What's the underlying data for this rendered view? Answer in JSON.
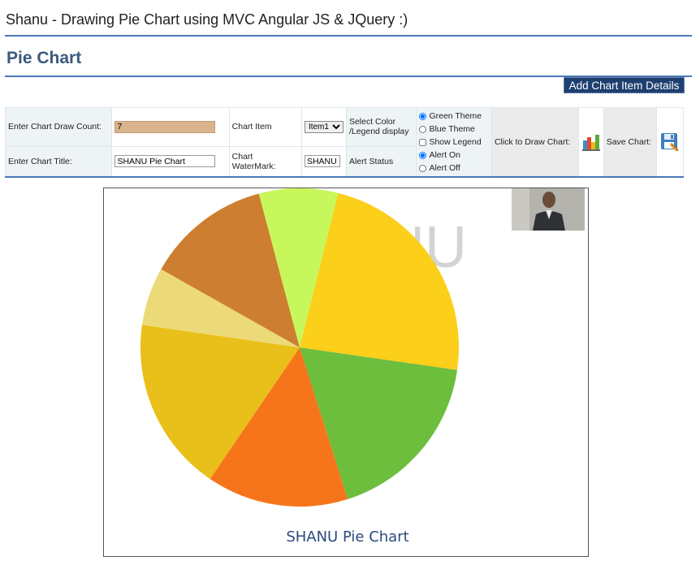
{
  "header": {
    "app_title": "Shanu - Drawing Pie Chart using MVC Angular JS & JQuery :)",
    "page_heading": "Pie Chart"
  },
  "toolbar": {
    "add_button_label": "Add Chart Item Details"
  },
  "controls": {
    "draw_count_label": "Enter Chart Draw Count:",
    "draw_count_value": "7",
    "chart_title_label": "Enter Chart Title:",
    "chart_title_value": "SHANU Pie Chart",
    "chart_item_label": "Chart Item",
    "chart_item_selected": "Item1",
    "watermark_label": "Chart WaterMark:",
    "watermark_value": "SHANU",
    "select_color_label": "Select Color /Legend display",
    "alert_status_label": "Alert Status",
    "options": {
      "green_theme": "Green Theme",
      "blue_theme": "Blue Theme",
      "show_legend": "Show Legend",
      "alert_on": "Alert On",
      "alert_off": "Alert Off"
    },
    "draw_label": "Click to Draw Chart:",
    "save_label": "Save Chart:"
  },
  "icons": {
    "draw": "bar-chart-icon",
    "save": "floppy-disk-icon"
  },
  "colors": {
    "accent_rule": "#4a78b6",
    "button_bg": "#1f3f70",
    "chart_title": "#2b4a7e",
    "watermark": "#d3d3d3"
  },
  "chart_data": {
    "type": "pie",
    "title": "SHANU Pie Chart",
    "watermark": "SHANU",
    "legend": "none",
    "slices": [
      {
        "value": 24.5,
        "color": "#fccf1a"
      },
      {
        "value": 18.7,
        "color": "#6dbe3c"
      },
      {
        "value": 15.1,
        "color": "#f7751a"
      },
      {
        "value": 18.6,
        "color": "#e9bf19"
      },
      {
        "value": 6.2,
        "color": "#ecd978"
      },
      {
        "value": 13.3,
        "color": "#ce7e31"
      },
      {
        "value": 8.4,
        "color": "#c7f75a"
      }
    ]
  }
}
